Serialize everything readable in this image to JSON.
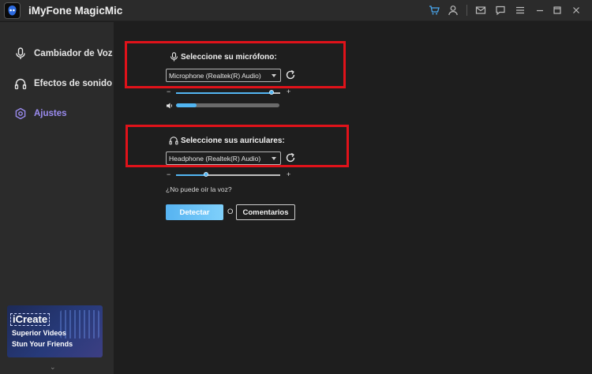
{
  "app": {
    "title": "iMyFone MagicMic"
  },
  "titlebar": {
    "icons": [
      "cart-icon",
      "user-icon",
      "mail-icon",
      "chat-icon",
      "settings-icon",
      "minimize-icon",
      "maximize-icon",
      "close-icon"
    ]
  },
  "sidebar": {
    "items": [
      {
        "label": "Cambiador de Voz",
        "icon": "microphone-icon",
        "active": false
      },
      {
        "label": "Efectos de sonido",
        "icon": "headphones-icon",
        "active": false
      },
      {
        "label": "Ajustes",
        "icon": "settings-icon",
        "active": true
      }
    ],
    "promo": {
      "brand": "iCreate",
      "line1": "Superior Videos",
      "line2": "Stun Your Friends"
    },
    "expand_glyph": "⌄"
  },
  "microphone": {
    "label": "Seleccione su micrófono:",
    "selected": "Microphone (Realtek(R) Audio)",
    "volume": 0.92,
    "input_level": 0.2,
    "minus": "−",
    "plus": "+"
  },
  "headphones": {
    "label": "Seleccione sus auriculares:",
    "selected": "Headphone (Realtek(R) Audio)",
    "volume": 0.29,
    "minus": "−",
    "plus": "+"
  },
  "help_text": "¿No puede oír la voz?",
  "actions": {
    "detect": "Detectar",
    "or": "O",
    "feedback": "Comentarios"
  },
  "colors": {
    "accent": "#53b6f3",
    "active_nav": "#9b8cf0",
    "highlight_box": "#e0121a"
  }
}
